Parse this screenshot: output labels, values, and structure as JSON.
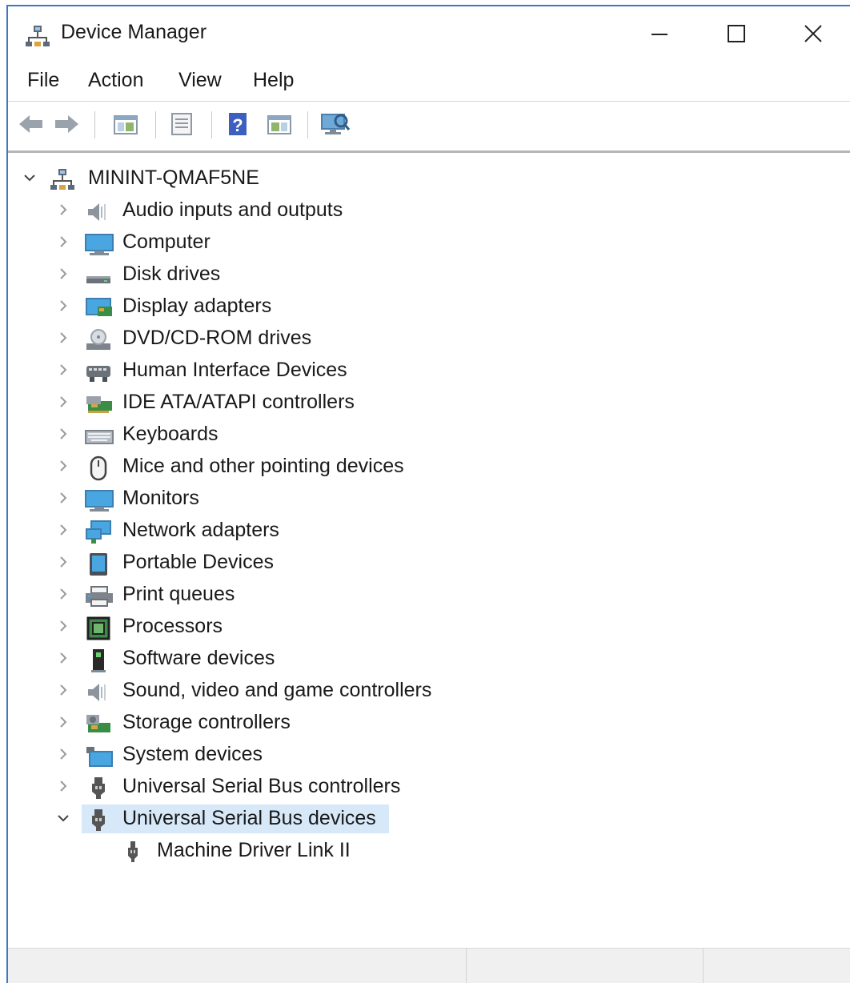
{
  "window": {
    "title": "Device Manager",
    "icon": "device-manager-icon",
    "controls": [
      "minimize-icon",
      "maximize-icon",
      "close-icon"
    ]
  },
  "menu": {
    "items": [
      {
        "label": "File"
      },
      {
        "label": "Action"
      },
      {
        "label": "View"
      },
      {
        "label": "Help"
      }
    ]
  },
  "toolbar": {
    "buttons": [
      "back-arrow-icon",
      "forward-arrow-icon",
      "show-hide-console-tree-icon",
      "properties-icon",
      "help-icon",
      "action-pane-icon",
      "scan-hardware-icon"
    ]
  },
  "tree": {
    "root": {
      "label": "MININT-QMAF5NE",
      "icon": "computer-network-icon",
      "expanded": true
    },
    "categories": [
      {
        "label": "Audio inputs and outputs",
        "icon": "speaker-icon"
      },
      {
        "label": "Computer",
        "icon": "computer-icon"
      },
      {
        "label": "Disk drives",
        "icon": "disk-drive-icon"
      },
      {
        "label": "Display adapters",
        "icon": "display-adapter-icon"
      },
      {
        "label": "DVD/CD-ROM drives",
        "icon": "dvd-drive-icon"
      },
      {
        "label": "Human Interface Devices",
        "icon": "hid-icon"
      },
      {
        "label": "IDE ATA/ATAPI controllers",
        "icon": "ide-controller-icon"
      },
      {
        "label": "Keyboards",
        "icon": "keyboard-icon"
      },
      {
        "label": "Mice and other pointing devices",
        "icon": "mouse-icon"
      },
      {
        "label": "Monitors",
        "icon": "monitor-icon"
      },
      {
        "label": "Network adapters",
        "icon": "network-adapter-icon"
      },
      {
        "label": "Portable Devices",
        "icon": "portable-device-icon"
      },
      {
        "label": "Print queues",
        "icon": "printer-icon"
      },
      {
        "label": "Processors",
        "icon": "processor-icon"
      },
      {
        "label": "Software devices",
        "icon": "software-device-icon"
      },
      {
        "label": "Sound, video and game controllers",
        "icon": "sound-controller-icon"
      },
      {
        "label": "Storage controllers",
        "icon": "storage-controller-icon"
      },
      {
        "label": "System devices",
        "icon": "system-devices-icon"
      },
      {
        "label": "Universal Serial Bus controllers",
        "icon": "usb-icon"
      },
      {
        "label": "Universal Serial Bus devices",
        "icon": "usb-icon",
        "expanded": true,
        "selected": true
      }
    ],
    "children": [
      {
        "label": "Machine Driver Link II",
        "icon": "usb-icon"
      }
    ]
  },
  "colors": {
    "window_border": "#3c78c4",
    "selection": "#d7e8f9",
    "statusbar": "#f0f0f0"
  }
}
